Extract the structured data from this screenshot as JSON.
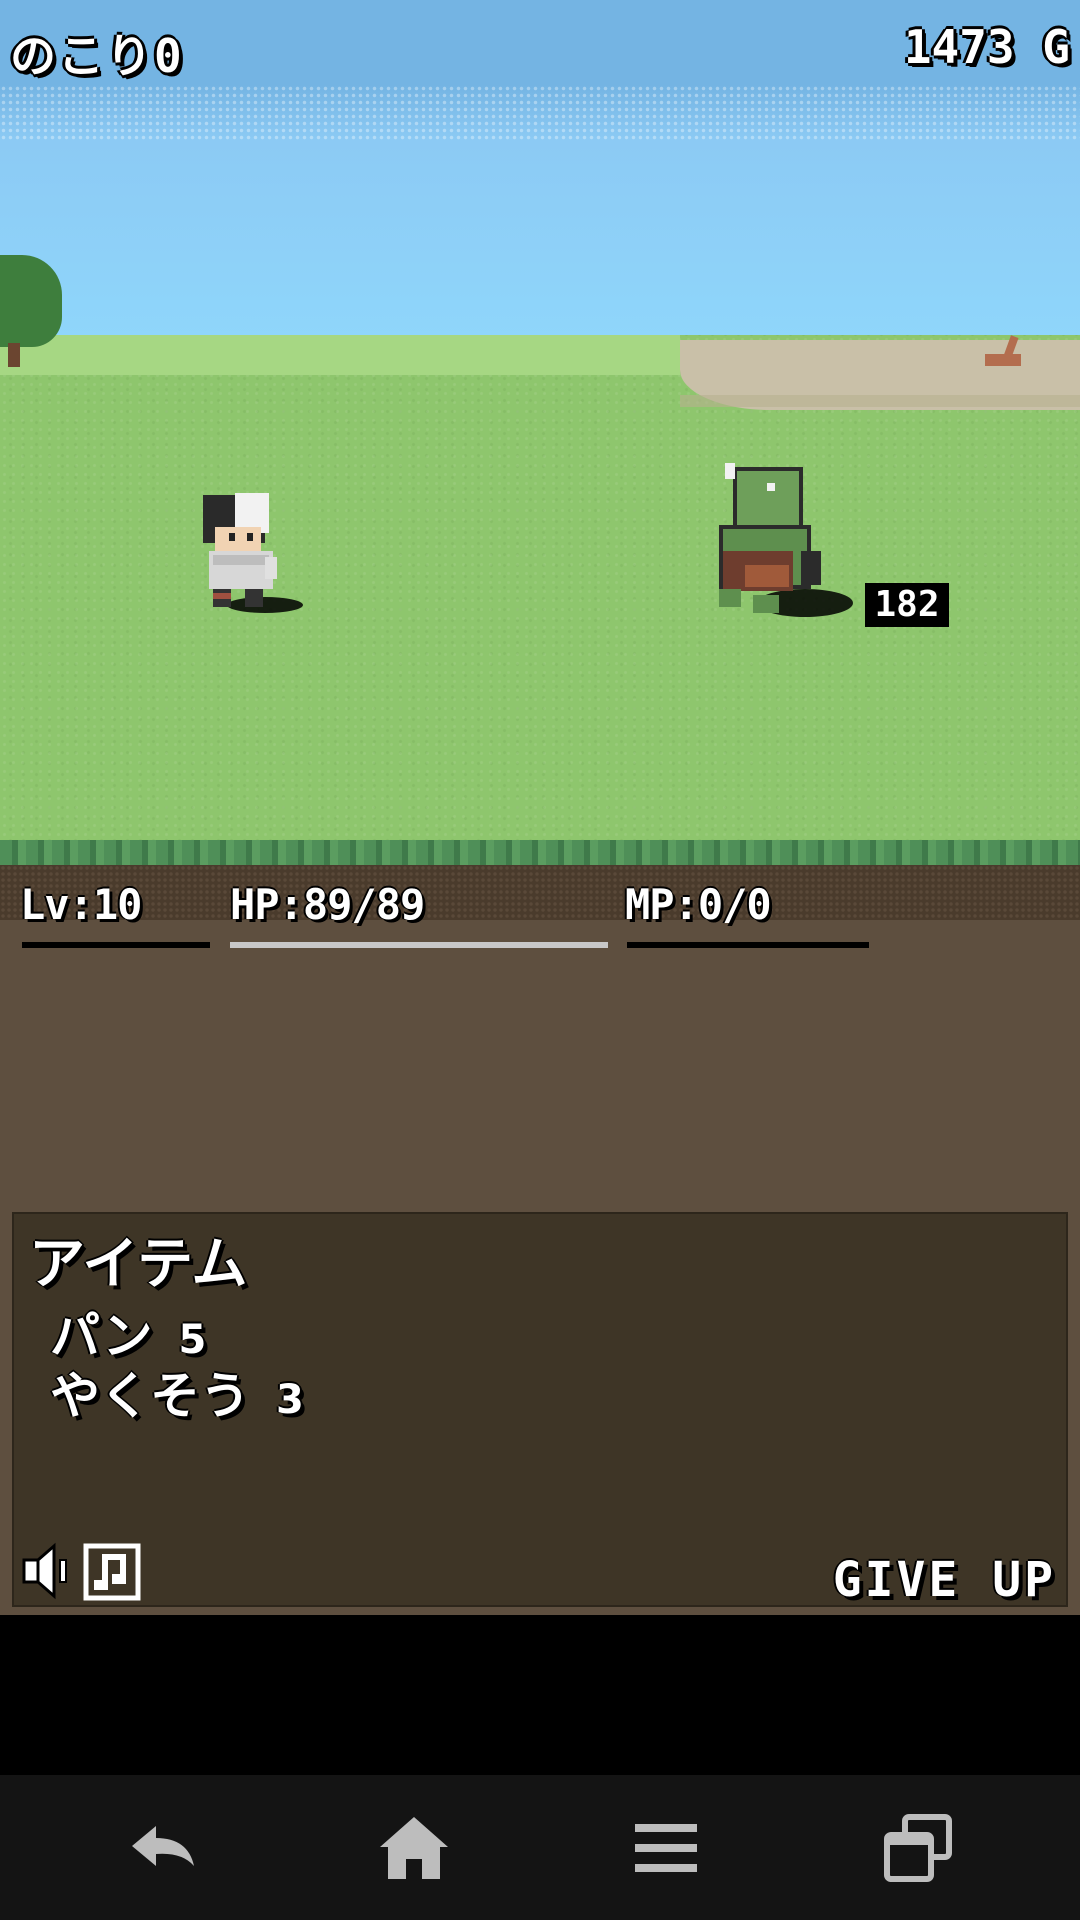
{
  "hud": {
    "left_label": "のこり0",
    "gold": "1473 G"
  },
  "battle": {
    "damage_number": "182"
  },
  "stats": {
    "level": "Lv:10",
    "hp": "HP:89/89",
    "hp_fraction": 1.0,
    "mp": "MP:0/0",
    "mp_fraction": 0.0
  },
  "item_panel": {
    "title": "アイテム",
    "items": [
      {
        "name": "パン",
        "qty": "5"
      },
      {
        "name": "やくそう",
        "qty": "3"
      }
    ],
    "give_up_label": "GIVE UP",
    "sound_icon": "speaker-icon",
    "music_icon": "music-note-icon"
  },
  "navbar": {
    "buttons": [
      "back-icon",
      "home-icon",
      "menu-icon",
      "recent-apps-icon"
    ]
  },
  "colors": {
    "sky": "#8fd6fb",
    "grass": "#8ec66d",
    "dirt": "#5e4f3f",
    "panel": "#3e3526",
    "hp_bar": "#c8c8c8",
    "navbar": "#141414"
  }
}
